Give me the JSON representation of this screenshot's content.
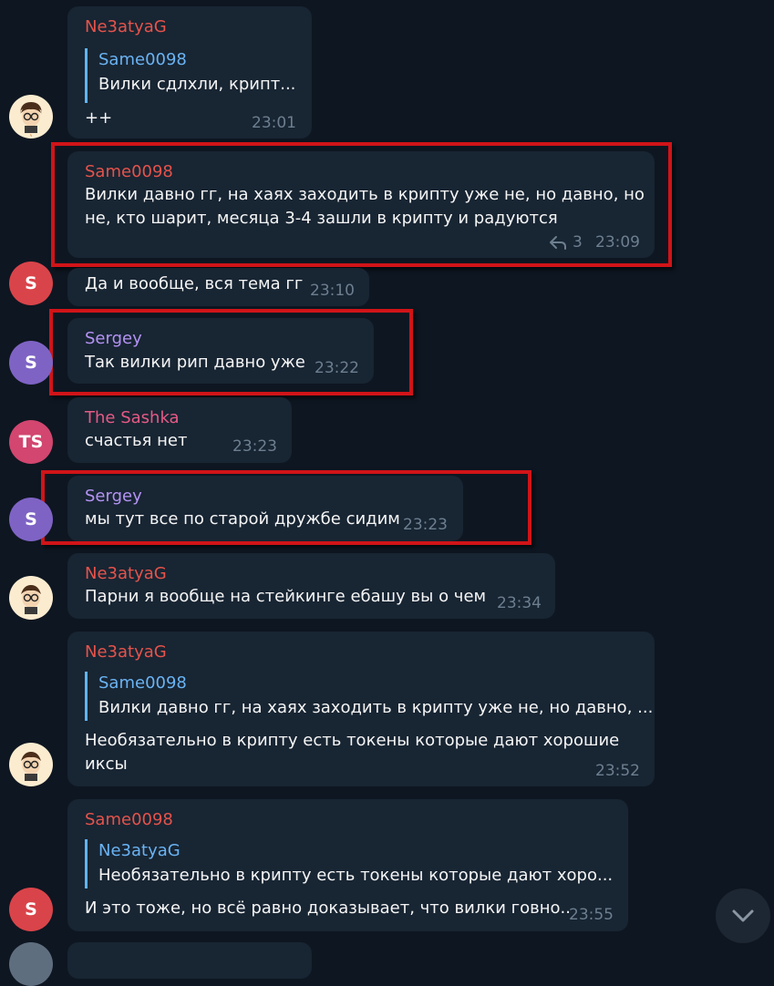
{
  "messages": [
    {
      "author": "Ne3atyaG",
      "reply_to": {
        "author": "Same0098",
        "text": "Вилки сдлхли, крипт..."
      },
      "text": "++",
      "time": "23:01"
    },
    {
      "author": "Same0098",
      "text_lines": [
        "Вилки давно гг, на хаях заходить в крипту уже не, но давно, но",
        "не, кто шарит, месяца 3-4 зашли в крипту и радуются"
      ],
      "reply_count": "3",
      "time": "23:09"
    },
    {
      "text": "Да и вообще, вся тема гг",
      "time": "23:10",
      "avatar_letter": "S"
    },
    {
      "author": "Sergey",
      "text": "Так вилки рип давно уже",
      "time": "23:22",
      "avatar_letter": "S"
    },
    {
      "author": "The Sashka",
      "text": "счастья нет",
      "time": "23:23",
      "avatar_letter": "TS"
    },
    {
      "author": "Sergey",
      "text": "мы тут все по старой дружбе сидим",
      "time": "23:23",
      "avatar_letter": "S"
    },
    {
      "author": "Ne3atyaG",
      "text": "Парни я вообще на стейкинге ебашу вы о чем",
      "time": "23:34"
    },
    {
      "author": "Ne3atyaG",
      "reply_to": {
        "author": "Same0098",
        "text": "Вилки давно гг, на хаях заходить в крипту уже не, но давно, ..."
      },
      "text_lines": [
        "Необязательно в крипту есть токены которые дают хорошие",
        "иксы"
      ],
      "time": "23:52"
    },
    {
      "author": "Same0098",
      "reply_to": {
        "author": "Ne3atyaG",
        "text": "Необязательно в крипту есть токены которые дают хоро..."
      },
      "text": "И это тоже, но всё равно доказывает, что вилки говно..",
      "time": "23:55",
      "avatar_letter": "S"
    }
  ],
  "colors": {
    "background": "#0e1621",
    "bubble": "#182533",
    "author_red": "#e5534b",
    "author_purple": "#b493f3",
    "author_pink": "#e55a85",
    "quote_author": "#6ab3f3",
    "timestamp": "#6d7f8f",
    "highlight_box": "#d01418"
  },
  "icons": {
    "reply": "reply-arrow-icon",
    "scroll": "chevron-down-icon"
  }
}
